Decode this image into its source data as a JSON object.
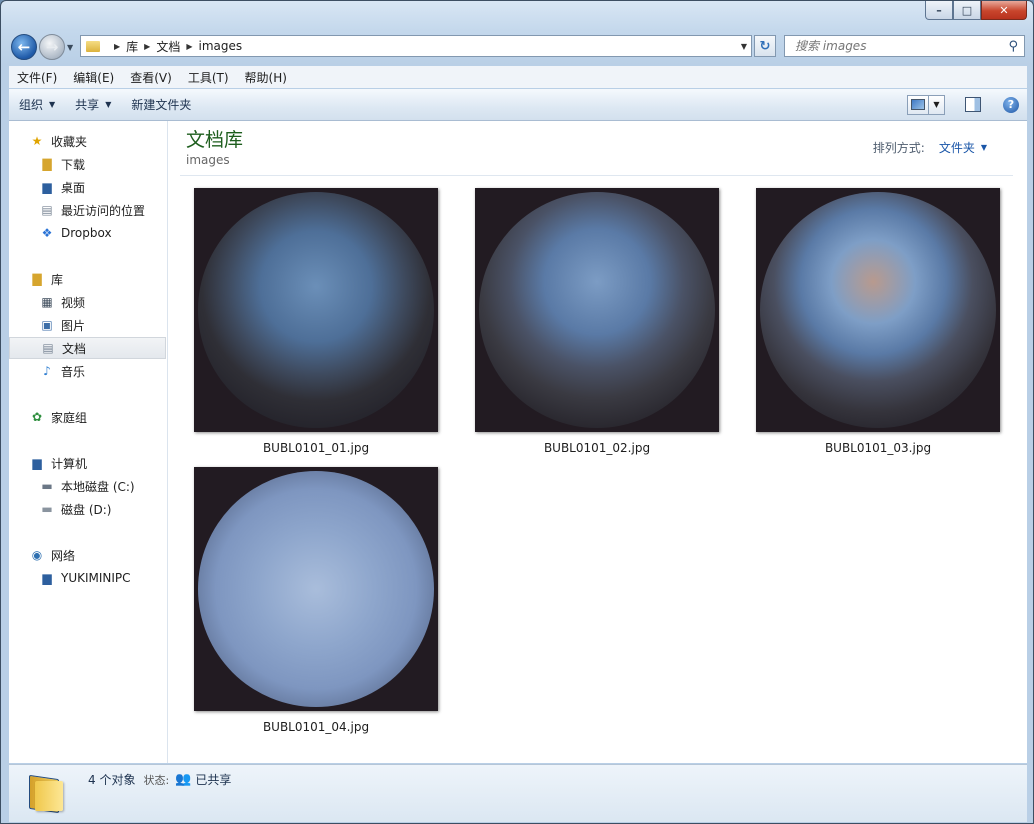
{
  "window": {
    "minimize": "–",
    "maximize": "□",
    "close": "✕"
  },
  "address": {
    "crumbs": [
      "库",
      "文档",
      "images"
    ],
    "search_placeholder": "搜索 images"
  },
  "menu": [
    "文件(F)",
    "编辑(E)",
    "查看(V)",
    "工具(T)",
    "帮助(H)"
  ],
  "commands": {
    "organize": "组织",
    "share": "共享",
    "new_folder": "新建文件夹",
    "help": "?"
  },
  "nav": {
    "favorites": "收藏夹",
    "downloads": "下载",
    "desktop": "桌面",
    "recent": "最近访问的位置",
    "dropbox": "Dropbox",
    "libraries": "库",
    "videos": "视频",
    "pictures": "图片",
    "documents": "文档",
    "music": "音乐",
    "homegroup": "家庭组",
    "computer": "计算机",
    "local_disk": "本地磁盘 (C:)",
    "disk_d": "磁盘 (D:)",
    "network": "网络",
    "pc": "YUKIMINIPC"
  },
  "content": {
    "library_title": "文档库",
    "library_sub": "images",
    "arrange_label": "排列方式:",
    "arrange_value": "文件夹"
  },
  "files": [
    {
      "name": "BUBL0101_01.jpg"
    },
    {
      "name": "BUBL0101_02.jpg"
    },
    {
      "name": "BUBL0101_03.jpg"
    },
    {
      "name": "BUBL0101_04.jpg"
    }
  ],
  "status": {
    "count": "4 个对象",
    "state_label": "状态:",
    "state_value": "已共享"
  }
}
